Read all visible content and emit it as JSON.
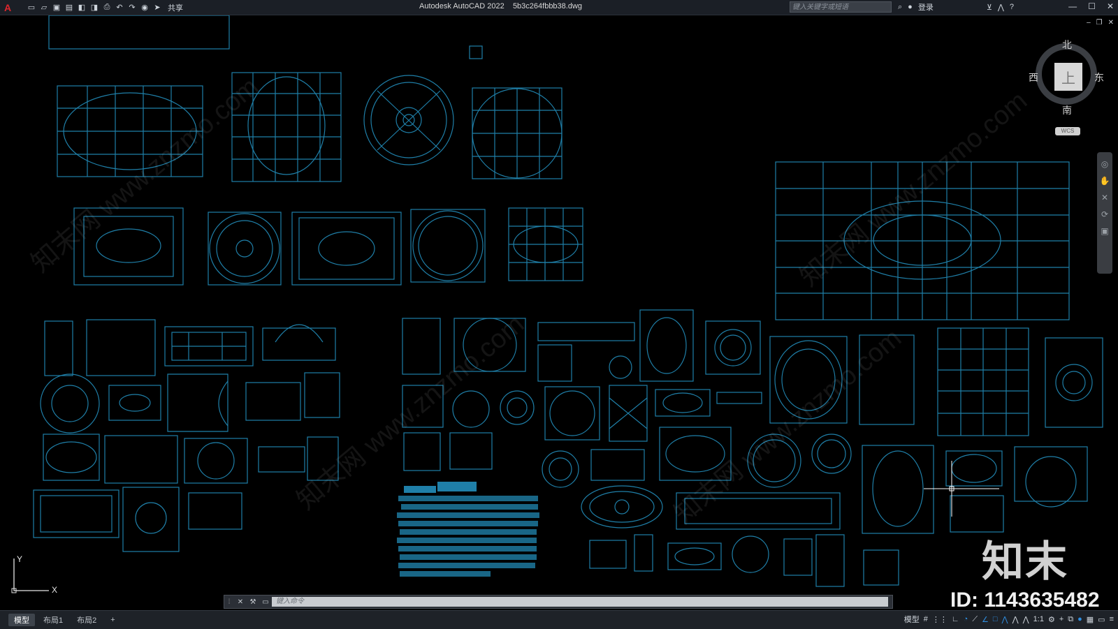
{
  "titlebar": {
    "app_logo": "A",
    "share_label": "共享",
    "app_name": "Autodesk AutoCAD 2022",
    "file_name": "5b3c264fbbb38.dwg",
    "search_placeholder": "键入关键字或短语",
    "login_label": "登录",
    "help_icon": "?"
  },
  "viewcube": {
    "north": "北",
    "south": "南",
    "east": "东",
    "west": "西",
    "face": "上",
    "wcs_label": "WCS"
  },
  "ucs": {
    "x_label": "X",
    "y_label": "Y"
  },
  "command_line": {
    "placeholder": "键入命令"
  },
  "layout_tabs": [
    {
      "label": "模型"
    },
    {
      "label": "布局1"
    },
    {
      "label": "布局2"
    },
    {
      "label": "+"
    }
  ],
  "statusbar": {
    "model_label": "模型",
    "scale_label": "1:1"
  },
  "watermark": {
    "logo": "知末",
    "id_text": "ID: 1143635482"
  },
  "colors": {
    "drawing_lines": "#1f7fa8",
    "background": "#000000"
  }
}
